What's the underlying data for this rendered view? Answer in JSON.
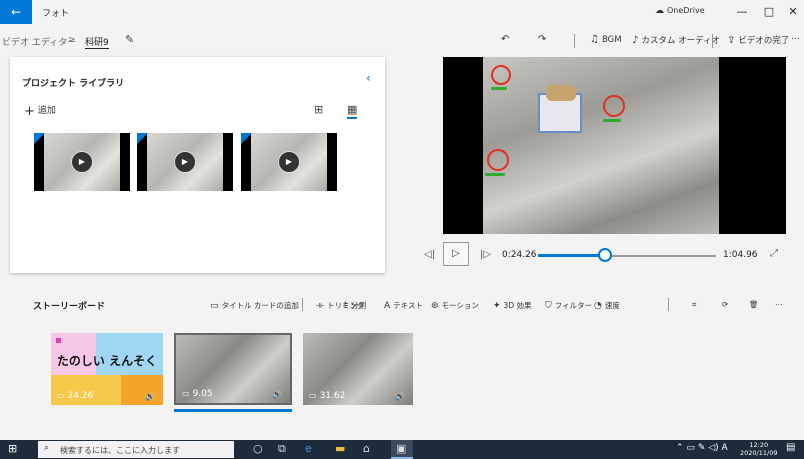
{
  "app": {
    "title": "フォト",
    "onedrive_label": "OneDrive"
  },
  "window_controls": {
    "minimize": "—",
    "maximize": "□",
    "close": "✕"
  },
  "breadcrumb": {
    "editor": "ビデオ エディター",
    "separator": ">",
    "project": "科研9"
  },
  "toolbar": {
    "bgm_label": "BGM",
    "custom_audio_label": "カスタム オーディオ",
    "finish_label": "ビデオの完了"
  },
  "library": {
    "title": "プロジェクト ライブラリ",
    "add_label": "追加"
  },
  "player": {
    "current_time": "0:24.26",
    "total_time": "1:04.96",
    "progress_fraction": 0.374
  },
  "storyboard": {
    "title": "ストーリーボード",
    "tools": [
      {
        "label": "タイトル カードの追加",
        "icon": "title-card-icon"
      },
      {
        "label": "トリミング",
        "icon": "trim-icon"
      },
      {
        "label": "分割",
        "icon": "split-icon"
      },
      {
        "label": "テキスト",
        "icon": "text-icon"
      },
      {
        "label": "モーション",
        "icon": "motion-icon"
      },
      {
        "label": "3D 効果",
        "icon": "3d-effects-icon"
      },
      {
        "label": "フィルター",
        "icon": "filter-icon"
      },
      {
        "label": "速度",
        "icon": "speed-icon"
      }
    ],
    "clips": [
      {
        "caption": "たのしい えんそく",
        "duration": "24.26"
      },
      {
        "caption": "",
        "duration": "9.05"
      },
      {
        "caption": "",
        "duration": "31.62"
      }
    ]
  },
  "taskbar": {
    "search_placeholder": "検索するには、ここに入力します",
    "ime_label": "A",
    "time": "12:20",
    "date": "2020/11/09"
  },
  "colors": {
    "accent": "#0078d7",
    "taskbar": "#1e2b3a"
  }
}
